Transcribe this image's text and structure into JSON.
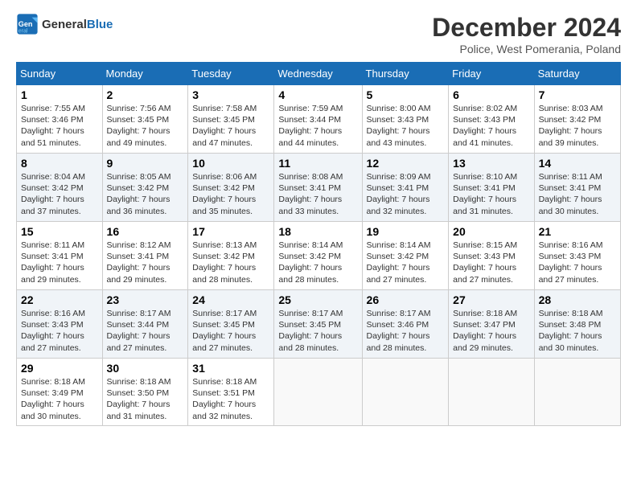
{
  "header": {
    "logo_line1": "General",
    "logo_line2": "Blue",
    "month": "December 2024",
    "location": "Police, West Pomerania, Poland"
  },
  "weekdays": [
    "Sunday",
    "Monday",
    "Tuesday",
    "Wednesday",
    "Thursday",
    "Friday",
    "Saturday"
  ],
  "weeks": [
    [
      {
        "day": "1",
        "sunrise": "Sunrise: 7:55 AM",
        "sunset": "Sunset: 3:46 PM",
        "daylight": "Daylight: 7 hours and 51 minutes."
      },
      {
        "day": "2",
        "sunrise": "Sunrise: 7:56 AM",
        "sunset": "Sunset: 3:45 PM",
        "daylight": "Daylight: 7 hours and 49 minutes."
      },
      {
        "day": "3",
        "sunrise": "Sunrise: 7:58 AM",
        "sunset": "Sunset: 3:45 PM",
        "daylight": "Daylight: 7 hours and 47 minutes."
      },
      {
        "day": "4",
        "sunrise": "Sunrise: 7:59 AM",
        "sunset": "Sunset: 3:44 PM",
        "daylight": "Daylight: 7 hours and 44 minutes."
      },
      {
        "day": "5",
        "sunrise": "Sunrise: 8:00 AM",
        "sunset": "Sunset: 3:43 PM",
        "daylight": "Daylight: 7 hours and 43 minutes."
      },
      {
        "day": "6",
        "sunrise": "Sunrise: 8:02 AM",
        "sunset": "Sunset: 3:43 PM",
        "daylight": "Daylight: 7 hours and 41 minutes."
      },
      {
        "day": "7",
        "sunrise": "Sunrise: 8:03 AM",
        "sunset": "Sunset: 3:42 PM",
        "daylight": "Daylight: 7 hours and 39 minutes."
      }
    ],
    [
      {
        "day": "8",
        "sunrise": "Sunrise: 8:04 AM",
        "sunset": "Sunset: 3:42 PM",
        "daylight": "Daylight: 7 hours and 37 minutes."
      },
      {
        "day": "9",
        "sunrise": "Sunrise: 8:05 AM",
        "sunset": "Sunset: 3:42 PM",
        "daylight": "Daylight: 7 hours and 36 minutes."
      },
      {
        "day": "10",
        "sunrise": "Sunrise: 8:06 AM",
        "sunset": "Sunset: 3:42 PM",
        "daylight": "Daylight: 7 hours and 35 minutes."
      },
      {
        "day": "11",
        "sunrise": "Sunrise: 8:08 AM",
        "sunset": "Sunset: 3:41 PM",
        "daylight": "Daylight: 7 hours and 33 minutes."
      },
      {
        "day": "12",
        "sunrise": "Sunrise: 8:09 AM",
        "sunset": "Sunset: 3:41 PM",
        "daylight": "Daylight: 7 hours and 32 minutes."
      },
      {
        "day": "13",
        "sunrise": "Sunrise: 8:10 AM",
        "sunset": "Sunset: 3:41 PM",
        "daylight": "Daylight: 7 hours and 31 minutes."
      },
      {
        "day": "14",
        "sunrise": "Sunrise: 8:11 AM",
        "sunset": "Sunset: 3:41 PM",
        "daylight": "Daylight: 7 hours and 30 minutes."
      }
    ],
    [
      {
        "day": "15",
        "sunrise": "Sunrise: 8:11 AM",
        "sunset": "Sunset: 3:41 PM",
        "daylight": "Daylight: 7 hours and 29 minutes."
      },
      {
        "day": "16",
        "sunrise": "Sunrise: 8:12 AM",
        "sunset": "Sunset: 3:41 PM",
        "daylight": "Daylight: 7 hours and 29 minutes."
      },
      {
        "day": "17",
        "sunrise": "Sunrise: 8:13 AM",
        "sunset": "Sunset: 3:42 PM",
        "daylight": "Daylight: 7 hours and 28 minutes."
      },
      {
        "day": "18",
        "sunrise": "Sunrise: 8:14 AM",
        "sunset": "Sunset: 3:42 PM",
        "daylight": "Daylight: 7 hours and 28 minutes."
      },
      {
        "day": "19",
        "sunrise": "Sunrise: 8:14 AM",
        "sunset": "Sunset: 3:42 PM",
        "daylight": "Daylight: 7 hours and 27 minutes."
      },
      {
        "day": "20",
        "sunrise": "Sunrise: 8:15 AM",
        "sunset": "Sunset: 3:43 PM",
        "daylight": "Daylight: 7 hours and 27 minutes."
      },
      {
        "day": "21",
        "sunrise": "Sunrise: 8:16 AM",
        "sunset": "Sunset: 3:43 PM",
        "daylight": "Daylight: 7 hours and 27 minutes."
      }
    ],
    [
      {
        "day": "22",
        "sunrise": "Sunrise: 8:16 AM",
        "sunset": "Sunset: 3:43 PM",
        "daylight": "Daylight: 7 hours and 27 minutes."
      },
      {
        "day": "23",
        "sunrise": "Sunrise: 8:17 AM",
        "sunset": "Sunset: 3:44 PM",
        "daylight": "Daylight: 7 hours and 27 minutes."
      },
      {
        "day": "24",
        "sunrise": "Sunrise: 8:17 AM",
        "sunset": "Sunset: 3:45 PM",
        "daylight": "Daylight: 7 hours and 27 minutes."
      },
      {
        "day": "25",
        "sunrise": "Sunrise: 8:17 AM",
        "sunset": "Sunset: 3:45 PM",
        "daylight": "Daylight: 7 hours and 28 minutes."
      },
      {
        "day": "26",
        "sunrise": "Sunrise: 8:17 AM",
        "sunset": "Sunset: 3:46 PM",
        "daylight": "Daylight: 7 hours and 28 minutes."
      },
      {
        "day": "27",
        "sunrise": "Sunrise: 8:18 AM",
        "sunset": "Sunset: 3:47 PM",
        "daylight": "Daylight: 7 hours and 29 minutes."
      },
      {
        "day": "28",
        "sunrise": "Sunrise: 8:18 AM",
        "sunset": "Sunset: 3:48 PM",
        "daylight": "Daylight: 7 hours and 30 minutes."
      }
    ],
    [
      {
        "day": "29",
        "sunrise": "Sunrise: 8:18 AM",
        "sunset": "Sunset: 3:49 PM",
        "daylight": "Daylight: 7 hours and 30 minutes."
      },
      {
        "day": "30",
        "sunrise": "Sunrise: 8:18 AM",
        "sunset": "Sunset: 3:50 PM",
        "daylight": "Daylight: 7 hours and 31 minutes."
      },
      {
        "day": "31",
        "sunrise": "Sunrise: 8:18 AM",
        "sunset": "Sunset: 3:51 PM",
        "daylight": "Daylight: 7 hours and 32 minutes."
      },
      null,
      null,
      null,
      null
    ]
  ]
}
